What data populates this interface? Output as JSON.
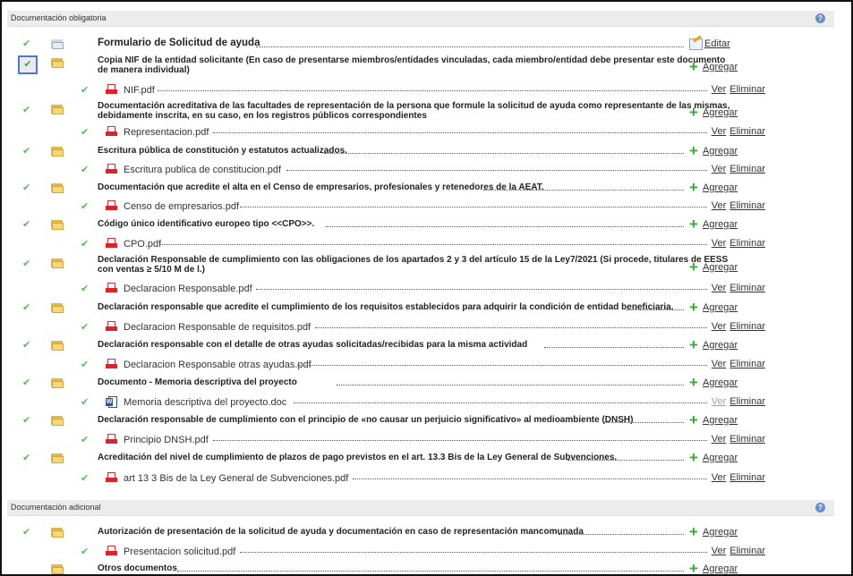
{
  "sections": [
    {
      "title": "Documentación obligatoria",
      "help": "?",
      "items": [
        {
          "title": "Formulario de Solicitud de ayuda",
          "action": "Editar"
        },
        {
          "title_lines": [
            "Copia NIF de la entidad solicitante (En caso de presentarse miembros/entidades vinculadas, cada miembro/entidad debe presentar este documento",
            "de manera individual)"
          ],
          "action": "Agregar",
          "file": "NIF.pdf"
        },
        {
          "title_lines": [
            "Documentación acreditativa de las facultades de representación de la persona que formule la solicitud de ayuda como representante de las mismas,",
            "debidamente inscrita, en su caso, en los registros públicos correspondientes"
          ],
          "action": "Agregar",
          "file": "Representacion.pdf"
        },
        {
          "title": "Escritura pública de constitución y estatutos actualizados.",
          "action": "Agregar",
          "file": "Escritura publica de constitucion.pdf"
        },
        {
          "title": "Documentación que acredite el alta en el Censo de empresarios, profesionales y retenedores de la AEAT.",
          "action": "Agregar",
          "file": "Censo de empresarios.pdf"
        },
        {
          "title": "Código único identificativo europeo tipo <<CPO>>.",
          "action": "Agregar",
          "file": "CPO.pdf"
        },
        {
          "title_lines": [
            "Declaración Responsable de cumplimiento con las obligaciones de los apartados 2 y 3 del artículo 15 de la Ley7/2021 (Si procede, titulares de EESS",
            "con ventas ≥ 5/10 M de l.)"
          ],
          "action": "Agregar",
          "file": "Declaracion Responsable.pdf"
        },
        {
          "title": "Declaración responsable que acredite el cumplimiento de los requisitos establecidos para adquirir la condición de entidad beneficiaria.",
          "action": "Agregar",
          "file": "Declaracion Responsable de requisitos.pdf"
        },
        {
          "title": "Declaración responsable con el detalle de otras ayudas solicitadas/recibidas para la misma actividad",
          "action": "Agregar",
          "file": "Declaracion Responsable otras ayudas.pdf"
        },
        {
          "title": "Documento - Memoria descriptiva del proyecto",
          "action": "Agregar",
          "file": "Memoria descriptiva del proyecto.doc"
        },
        {
          "title": "Declaración responsable de cumplimiento con el principio de «no causar un perjuicio significativo» al medioambiente (DNSH)",
          "action": "Agregar",
          "file": "Principio DNSH.pdf"
        },
        {
          "title": "Acreditación del nivel de cumplimiento de plazos de pago previstos en el art. 13.3 Bis de la Ley General de Subvenciones.",
          "action": "Agregar",
          "file": "art 13 3 Bis de la Ley General de Subvenciones.pdf"
        }
      ]
    },
    {
      "title": "Documentación adicional",
      "help": "?",
      "items": [
        {
          "title": "Autorización de presentación de la solicitud de ayuda y documentación en caso de representación mancomunada",
          "action": "Agregar",
          "file": "Presentacion solicitud.pdf"
        },
        {
          "title": "Otros documentos",
          "action": "Agregar"
        }
      ]
    }
  ],
  "labels": {
    "ver": "Ver",
    "eliminar": "Eliminar"
  },
  "glyphs": {
    "check": "✔",
    "plus": "+"
  }
}
